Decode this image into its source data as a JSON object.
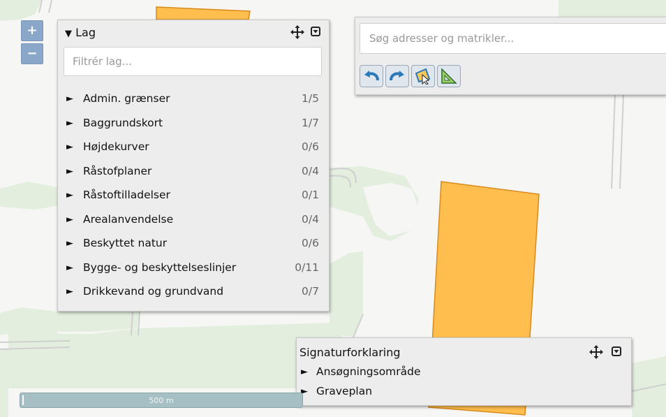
{
  "zoom": {
    "in_label": "+",
    "out_label": "−"
  },
  "layer_panel": {
    "title": "Lag",
    "title_arrow": "▼",
    "filter_placeholder": "Filtrér lag...",
    "items": [
      {
        "arrow": "►",
        "name": "Admin. grænser",
        "count": "1/5"
      },
      {
        "arrow": "►",
        "name": "Baggrundskort",
        "count": "1/7"
      },
      {
        "arrow": "►",
        "name": "Højdekurver",
        "count": "0/6"
      },
      {
        "arrow": "►",
        "name": "Råstofplaner",
        "count": "0/4"
      },
      {
        "arrow": "►",
        "name": "Råstoftilladelser",
        "count": "0/1"
      },
      {
        "arrow": "►",
        "name": "Arealanvendelse",
        "count": "0/4"
      },
      {
        "arrow": "►",
        "name": "Beskyttet natur",
        "count": "0/6"
      },
      {
        "arrow": "►",
        "name": "Bygge- og beskyttelseslinjer",
        "count": "0/11"
      },
      {
        "arrow": "►",
        "name": "Drikkevand og grundvand",
        "count": "0/7"
      }
    ]
  },
  "search_panel": {
    "placeholder": "Søg adresser og matrikler...",
    "tools": [
      "undo-icon",
      "redo-icon",
      "select-polygon-icon",
      "measure-icon"
    ]
  },
  "legend_panel": {
    "title": "Signaturforklaring",
    "items": [
      {
        "arrow": "►",
        "name": "Ansøgningsområde"
      },
      {
        "arrow": "►",
        "name": "Graveplan"
      }
    ]
  },
  "scale_bar": {
    "label": "500 m"
  },
  "colors": {
    "polygon_fill": "#ffbe4d",
    "polygon_stroke": "#d98a1a",
    "green_area": "#e4eedf",
    "road": "#d9d9d9",
    "panel_bg": "#ededed",
    "zoom_btn": "#8aa6c8"
  }
}
